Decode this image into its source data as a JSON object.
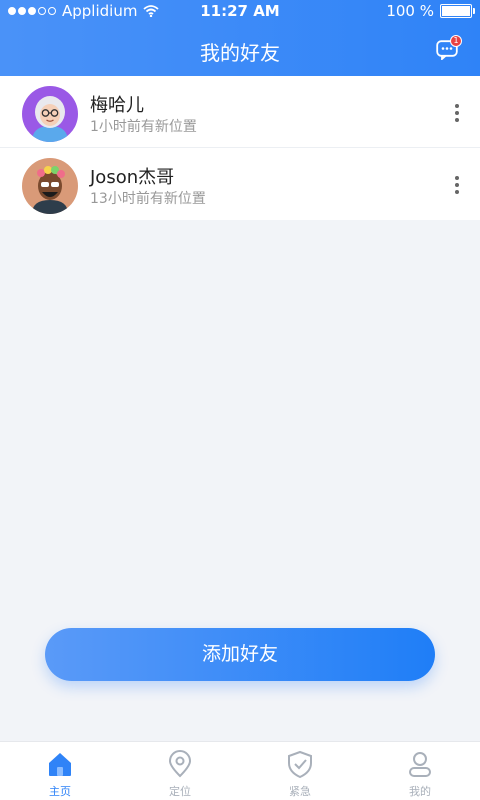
{
  "statusbar": {
    "carrier": "Applidium",
    "time": "11:27 AM",
    "battery": "100 %"
  },
  "header": {
    "title": "我的好友",
    "badge_count": "1"
  },
  "friends": [
    {
      "name": "梅哈儿",
      "status": "1小时前有新位置",
      "avatar": "avatar-grandma"
    },
    {
      "name": "Joson杰哥",
      "status": "13小时前有新位置",
      "avatar": "avatar-flower-crown"
    }
  ],
  "actions": {
    "add_friend": "添加好友"
  },
  "tabbar": {
    "items": [
      {
        "label": "主页",
        "icon": "home-icon",
        "active": true
      },
      {
        "label": "定位",
        "icon": "location-pin-icon",
        "active": false
      },
      {
        "label": "紧急",
        "icon": "shield-check-icon",
        "active": false
      },
      {
        "label": "我的",
        "icon": "user-icon",
        "active": false
      }
    ]
  },
  "colors": {
    "primary": "#2f83f7",
    "background": "#f2f4f8",
    "badge": "#e94242",
    "inactive": "#a9b0ba"
  }
}
